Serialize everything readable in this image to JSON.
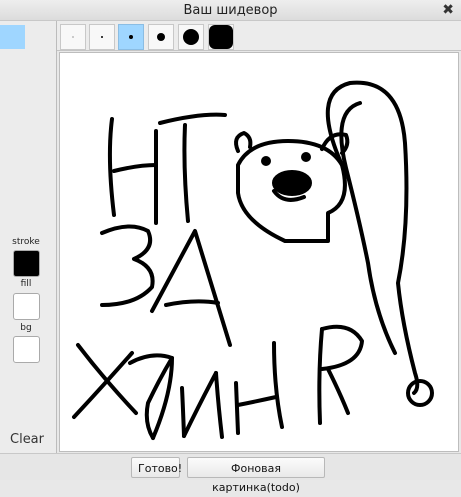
{
  "window": {
    "title": "Ваш шидевор",
    "close_glyph": "✖"
  },
  "left_panel": {
    "stroke_label": "stroke",
    "fill_label": "fill",
    "bg_label": "bg",
    "clear_label": "Clear",
    "colors": {
      "stroke": "#000000",
      "fill": "#ffffff",
      "bg": "#ffffff",
      "active_tool": "#9fd6ff"
    }
  },
  "toolbar": {
    "brush_sizes": [
      1,
      2,
      4,
      8,
      14,
      20
    ],
    "selected_brush_index": 2
  },
  "bottom": {
    "done_label": "Готово!",
    "bg_image_label": "Фоновая картинка(todo)"
  }
}
